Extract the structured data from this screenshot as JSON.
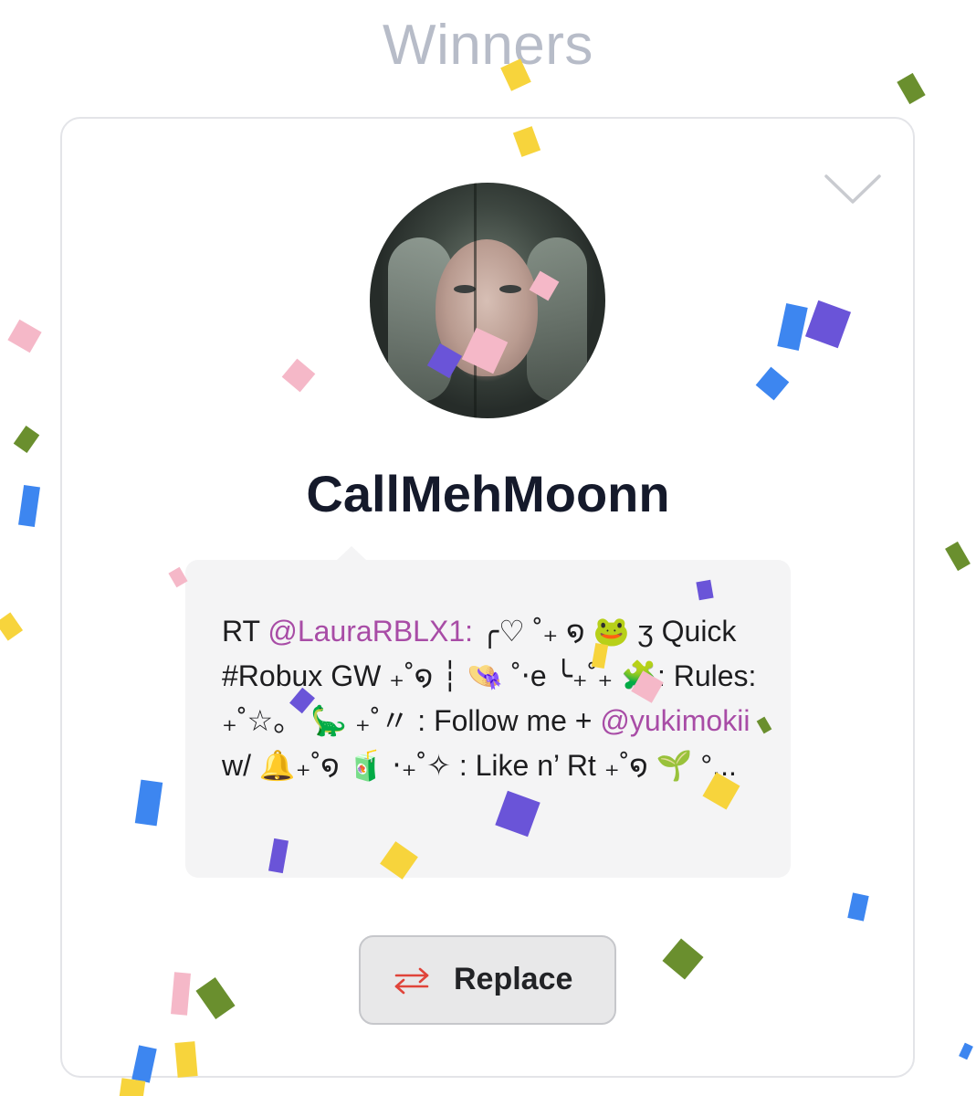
{
  "page": {
    "title": "Winners"
  },
  "winner": {
    "username": "CallMehMoonn",
    "avatar_alt": "profile photo",
    "tweet": {
      "prefix": "RT ",
      "mention1": "@LauraRBLX1:",
      "text1": " ╭♡ ˚₊ ໑ 🐸 ʒ Quick #Robux GW ₊˚໑ ┆ 👒 ˚‧e ╰₊˚₊ 🧩: Rules: ₊˚☆。 🦕 ₊˚〃 : Follow me + ",
      "mention2": "@yukimokii",
      "text2": " w/ 🔔₊˚໑ 🧃 ‧₊˚✧ : Like n’ Rt ₊˚໑ 🌱 °..."
    }
  },
  "actions": {
    "replace_label": "Replace"
  },
  "colors": {
    "title": "#b7bcc8",
    "mention": "#a84ca6",
    "replace_icon": "#e0443a",
    "confetti": [
      "#f7d43c",
      "#3d86f0",
      "#6a54d8",
      "#f5b8c8",
      "#6a8f2e"
    ]
  },
  "icons": {
    "collapse": "chevron-down-icon",
    "replace": "swap-arrows-icon"
  }
}
